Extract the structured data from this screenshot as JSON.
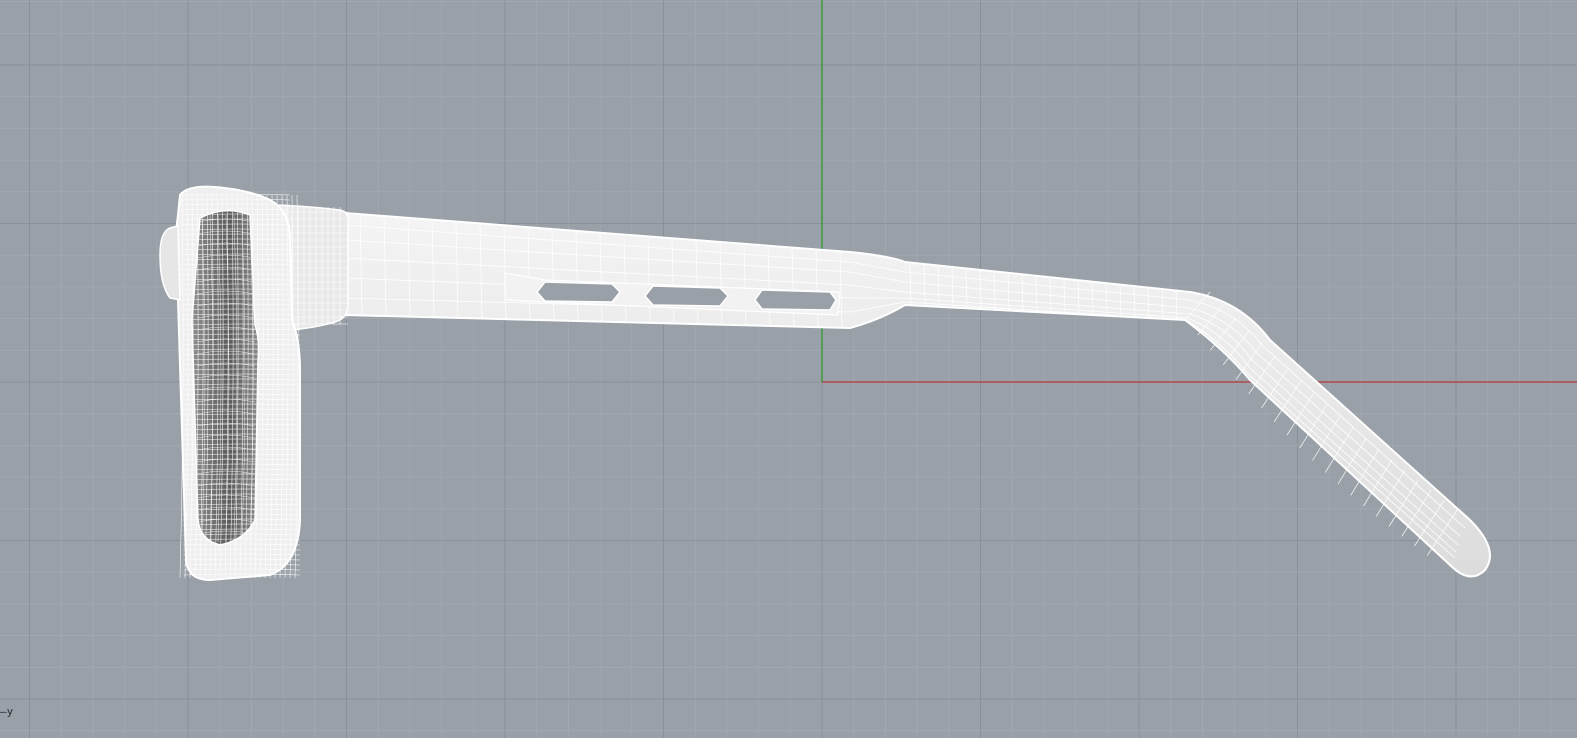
{
  "viewport": {
    "background": "#9aa0a8",
    "grid_minor_color": "#a3a9b0",
    "grid_major_color": "#8a9098",
    "x_axis_color": "#b04a4a",
    "y_axis_color": "#3a9a3a",
    "axis_label": "—y"
  },
  "model": {
    "object": "sunglasses-side-wireframe",
    "wire_color": "#ffffff",
    "shade_color": "#e4e4e4",
    "lens_shade_color": "#6a6a6a"
  }
}
